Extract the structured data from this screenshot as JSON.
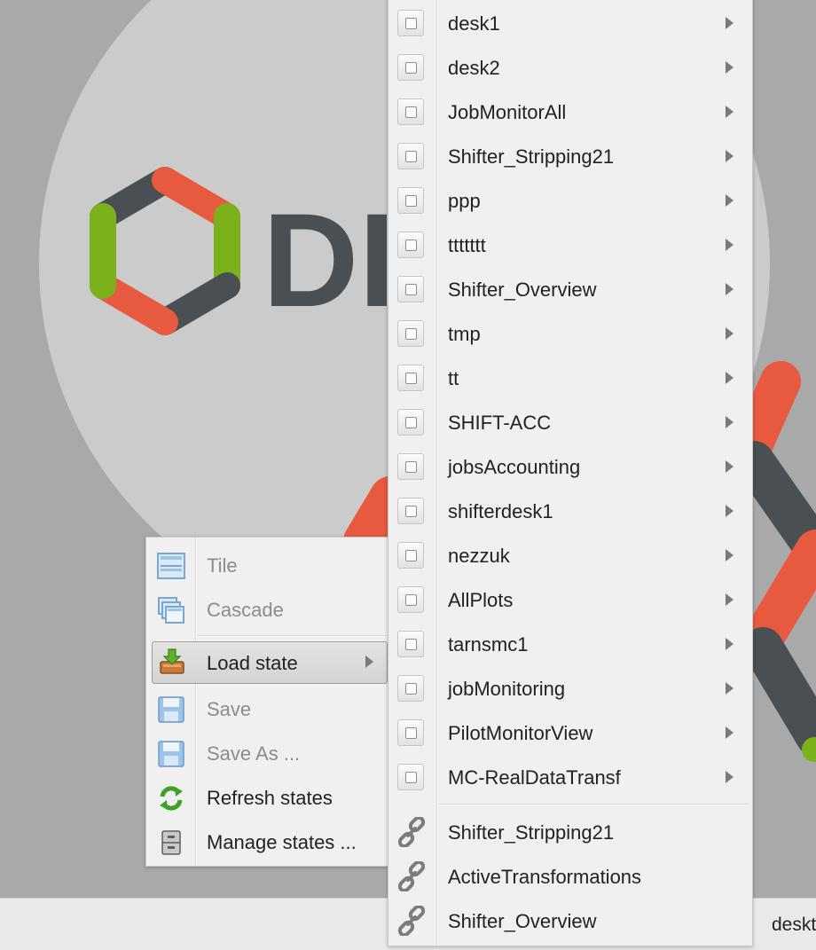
{
  "desktop": {
    "logo_text": "DI",
    "colors": {
      "hex_dark": "#4a4f53",
      "hex_red": "#e85a3f",
      "hex_green": "#7bb21c"
    }
  },
  "taskbar": {
    "item_label": "desktop"
  },
  "context_menu": {
    "items": [
      {
        "label": "Tile",
        "icon": "tile-icon",
        "enabled": false
      },
      {
        "label": "Cascade",
        "icon": "cascade-icon",
        "enabled": false
      },
      {
        "label": "Load state",
        "icon": "load-state-icon",
        "enabled": true,
        "submenu": true,
        "highlighted": true
      },
      {
        "label": "Save",
        "icon": "floppy-disk-icon",
        "enabled": false
      },
      {
        "label": "Save As ...",
        "icon": "floppy-disk-icon",
        "enabled": false
      },
      {
        "label": "Refresh states",
        "icon": "refresh-icon",
        "enabled": true
      },
      {
        "label": "Manage states ...",
        "icon": "file-cabinet-icon",
        "enabled": true
      }
    ]
  },
  "load_state_submenu": {
    "states": [
      "desk1",
      "desk2",
      "JobMonitorAll",
      "Shifter_Stripping21",
      "ppp",
      "ttttttt",
      "Shifter_Overview",
      "tmp",
      "tt",
      "SHIFT-ACC",
      "jobsAccounting",
      "shifterdesk1",
      "nezzuk",
      "AllPlots",
      "tarnsmc1",
      "jobMonitoring",
      "PilotMonitorView",
      "MC-RealDataTransf"
    ],
    "links": [
      "Shifter_Stripping21",
      "ActiveTransformations",
      "Shifter_Overview"
    ]
  }
}
